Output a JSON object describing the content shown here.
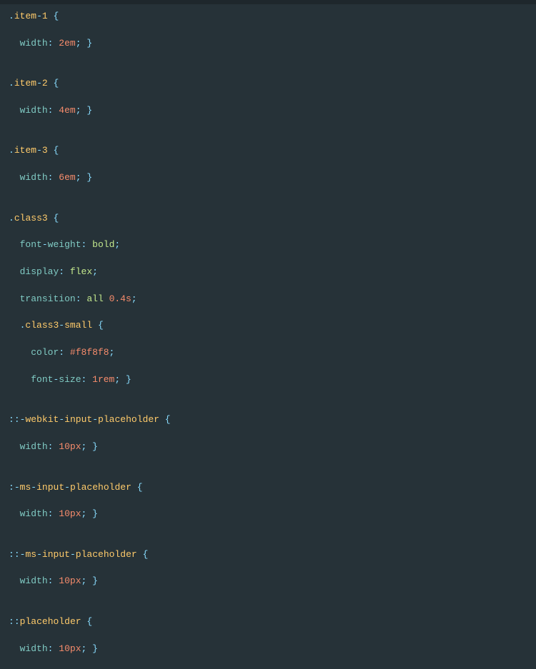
{
  "css_rules": [
    {
      "selector": ".item-1",
      "declarations": [
        {
          "property": "width",
          "value_tokens": [
            {
              "t": "num",
              "v": "2em"
            }
          ]
        }
      ],
      "nested": []
    },
    {
      "selector": ".item-2",
      "declarations": [
        {
          "property": "width",
          "value_tokens": [
            {
              "t": "num",
              "v": "4em"
            }
          ]
        }
      ],
      "nested": []
    },
    {
      "selector": ".item-3",
      "declarations": [
        {
          "property": "width",
          "value_tokens": [
            {
              "t": "num",
              "v": "6em"
            }
          ]
        }
      ],
      "nested": []
    },
    {
      "selector": ".class3",
      "declarations": [
        {
          "property": "font-weight",
          "value_tokens": [
            {
              "t": "kw",
              "v": "bold"
            }
          ]
        },
        {
          "property": "display",
          "value_tokens": [
            {
              "t": "kw",
              "v": "flex"
            }
          ]
        },
        {
          "property": "transition",
          "value_tokens": [
            {
              "t": "kw",
              "v": "all"
            },
            {
              "t": "sp"
            },
            {
              "t": "num",
              "v": "0.4s"
            }
          ]
        }
      ],
      "nested": [
        {
          "selector": ".class3-small",
          "declarations": [
            {
              "property": "color",
              "value_tokens": [
                {
                  "t": "num",
                  "v": "#f8f8f8"
                }
              ]
            },
            {
              "property": "font-size",
              "value_tokens": [
                {
                  "t": "num",
                  "v": "1rem"
                }
              ]
            }
          ]
        }
      ]
    },
    {
      "selector": "::-webkit-input-placeholder",
      "declarations": [
        {
          "property": "width",
          "value_tokens": [
            {
              "t": "num",
              "v": "10px"
            }
          ]
        }
      ],
      "nested": []
    },
    {
      "selector": ":-ms-input-placeholder",
      "declarations": [
        {
          "property": "width",
          "value_tokens": [
            {
              "t": "num",
              "v": "10px"
            }
          ]
        }
      ],
      "nested": []
    },
    {
      "selector": "::-ms-input-placeholder",
      "declarations": [
        {
          "property": "width",
          "value_tokens": [
            {
              "t": "num",
              "v": "10px"
            }
          ]
        }
      ],
      "nested": []
    },
    {
      "selector": "::placeholder",
      "declarations": [
        {
          "property": "width",
          "value_tokens": [
            {
              "t": "num",
              "v": "10px"
            }
          ]
        }
      ],
      "nested": []
    }
  ]
}
